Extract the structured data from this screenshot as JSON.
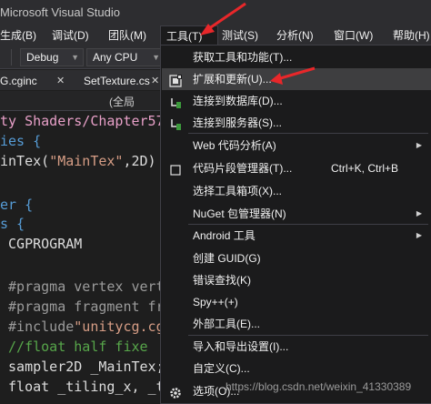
{
  "title_bar": {
    "title": "Microsoft Visual Studio"
  },
  "menubar": {
    "items": [
      "生成(B)",
      "调试(D)",
      "团队(M)",
      "工具(T)",
      "测试(S)",
      "分析(N)",
      "窗口(W)",
      "帮助(H)"
    ]
  },
  "toolbar": {
    "config_value": "Debug",
    "platform_value": "Any CPU"
  },
  "tabs": [
    {
      "label": "G.cginc",
      "close": "✕"
    },
    {
      "label": "SetTexture.cs",
      "close": "✕"
    }
  ],
  "navbar": {
    "text": "(全局"
  },
  "code": {
    "lines": [
      [
        {
          "t": "ty Shaders/Chapter57",
          "c": "pink"
        }
      ],
      [
        {
          "t": "ies {",
          "c": "blue"
        }
      ],
      [
        {
          "t": "inTex(",
          "c": "white"
        },
        {
          "t": "\"MainTex\"",
          "c": "red"
        },
        {
          "t": ",2D)",
          "c": "white"
        }
      ],
      [
        {
          "t": "",
          "c": "white"
        }
      ],
      [
        {
          "t": "er {",
          "c": "blue"
        }
      ],
      [
        {
          "t": "s {",
          "c": "blue"
        }
      ],
      [
        {
          "t": " CGPROGRAM",
          "c": "white"
        }
      ],
      [
        {
          "t": "",
          "c": "white"
        }
      ],
      [
        {
          "t": " #pragma vertex vert",
          "c": "grey"
        }
      ],
      [
        {
          "t": " #pragma fragment fr",
          "c": "grey"
        }
      ],
      [
        {
          "t": " #include",
          "c": "grey"
        },
        {
          "t": "\"unitycg.cg",
          "c": "red"
        }
      ],
      [
        {
          "t": " //float half fixe",
          "c": "green"
        }
      ],
      [
        {
          "t": " sampler2D _MainTex;",
          "c": "white"
        }
      ],
      [
        {
          "t": " float _tiling_x, _t",
          "c": "white"
        }
      ]
    ]
  },
  "tools_menu": {
    "items": [
      {
        "label": "获取工具和功能(T)...",
        "shortcut": "",
        "icon": "",
        "submenu": false
      },
      {
        "label": "扩展和更新(U)...",
        "shortcut": "",
        "icon": "extensions-icon",
        "submenu": false
      },
      {
        "label": "连接到数据库(D)...",
        "shortcut": "",
        "icon": "database-icon",
        "submenu": false
      },
      {
        "label": "连接到服务器(S)...",
        "shortcut": "",
        "icon": "server-icon",
        "submenu": false
      },
      {
        "label": "Web 代码分析(A)",
        "shortcut": "",
        "icon": "",
        "submenu": true
      },
      {
        "label": "代码片段管理器(T)...",
        "shortcut": "Ctrl+K, Ctrl+B",
        "icon": "checkbox-icon",
        "submenu": false
      },
      {
        "label": "选择工具箱项(X)...",
        "shortcut": "",
        "icon": "",
        "submenu": false
      },
      {
        "label": "NuGet 包管理器(N)",
        "shortcut": "",
        "icon": "",
        "submenu": true
      },
      {
        "label": "Android 工具",
        "shortcut": "",
        "icon": "",
        "submenu": true
      },
      {
        "label": "创建 GUID(G)",
        "shortcut": "",
        "icon": "",
        "submenu": false
      },
      {
        "label": "错误查找(K)",
        "shortcut": "",
        "icon": "",
        "submenu": false
      },
      {
        "label": "Spy++(+)",
        "shortcut": "",
        "icon": "",
        "submenu": false
      },
      {
        "label": "外部工具(E)...",
        "shortcut": "",
        "icon": "",
        "submenu": false
      },
      {
        "label": "导入和导出设置(I)...",
        "shortcut": "",
        "icon": "",
        "submenu": false
      },
      {
        "label": "自定义(C)...",
        "shortcut": "",
        "icon": "",
        "submenu": false
      },
      {
        "label": "选项(O)...",
        "shortcut": "",
        "icon": "gear-icon",
        "submenu": false
      }
    ]
  },
  "watermark": "https://blog.csdn.net/weixin_41330389",
  "colors": {
    "menu_bg": "#1b1b1c",
    "highlight": "#3e3e40",
    "annotation_arrow": "#e8272a"
  }
}
